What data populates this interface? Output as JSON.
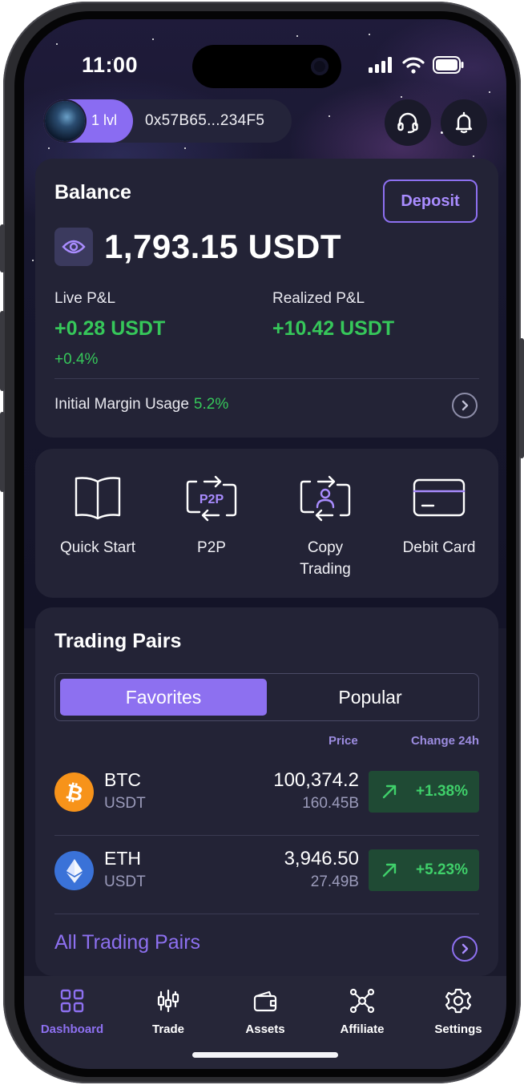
{
  "status_bar": {
    "time": "11:00"
  },
  "header": {
    "level": "1 lvl",
    "wallet_address": "0x57B65...234F5",
    "support_icon": "headset-icon",
    "notification_icon": "bell-icon"
  },
  "balance": {
    "title": "Balance",
    "deposit_label": "Deposit",
    "amount": "1,793.15 USDT",
    "live_pl_label": "Live P&L",
    "live_pl_value": "+0.28 USDT",
    "live_pl_pct": "+0.4%",
    "realized_pl_label": "Realized P&L",
    "realized_pl_value": "+10.42 USDT",
    "margin_label": "Initial Margin Usage",
    "margin_value": "5.2%"
  },
  "actions": [
    {
      "label": "Quick Start",
      "icon": "book-icon"
    },
    {
      "label": "P2P",
      "icon": "p2p-exchange-icon"
    },
    {
      "label": "Copy Trading",
      "icon": "copy-trading-icon"
    },
    {
      "label": "Debit Card",
      "icon": "card-icon"
    }
  ],
  "trading_pairs": {
    "title": "Trading Pairs",
    "tabs": [
      "Favorites",
      "Popular"
    ],
    "active_tab": "Favorites",
    "col_price": "Price",
    "col_change": "Change 24h",
    "rows": [
      {
        "base": "BTC",
        "quote": "USDT",
        "price": "100,374.2",
        "volume": "160.45B",
        "change": "+1.38%"
      },
      {
        "base": "ETH",
        "quote": "USDT",
        "price": "3,946.50",
        "volume": "27.49B",
        "change": "+5.23%"
      }
    ],
    "all_label": "All Trading Pairs"
  },
  "tabbar": [
    {
      "label": "Dashboard",
      "icon": "grid-icon",
      "active": true
    },
    {
      "label": "Trade",
      "icon": "candlestick-icon",
      "active": false
    },
    {
      "label": "Assets",
      "icon": "wallet-icon",
      "active": false
    },
    {
      "label": "Affiliate",
      "icon": "network-icon",
      "active": false
    },
    {
      "label": "Settings",
      "icon": "gear-icon",
      "active": false
    }
  ],
  "colors": {
    "accent": "#8d70f0",
    "positive": "#36c75a",
    "card": "#232336",
    "background": "#1a1a2c"
  }
}
